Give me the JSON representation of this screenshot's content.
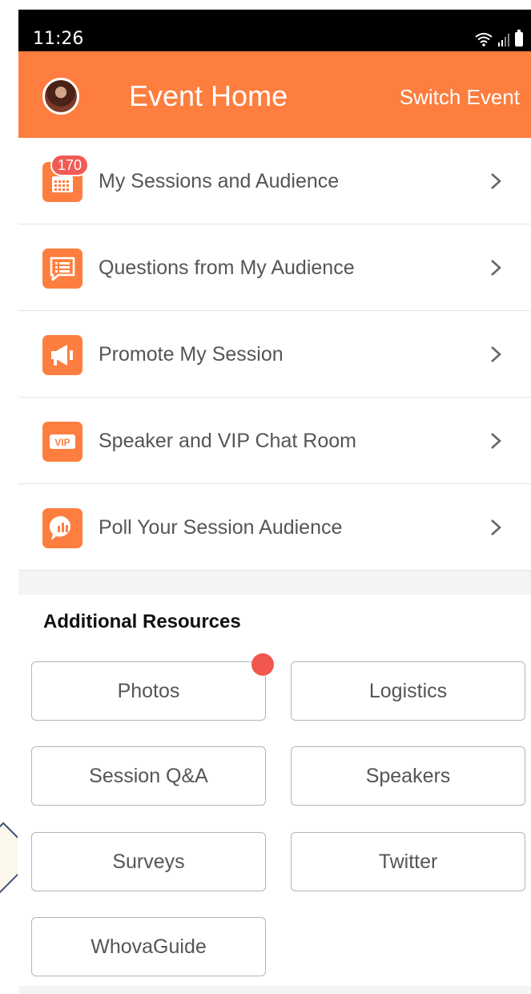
{
  "status_bar": {
    "time": "11:26"
  },
  "header": {
    "title": "Event Home",
    "switch_label": "Switch Event",
    "color": "#fd7e3f"
  },
  "menu": [
    {
      "label": "My Sessions and Audience",
      "icon": "calendar-icon",
      "badge": "170"
    },
    {
      "label": "Questions from My Audience",
      "icon": "question-list-icon"
    },
    {
      "label": "Promote My Session",
      "icon": "megaphone-icon"
    },
    {
      "label": "Speaker and VIP Chat Room",
      "icon": "vip-icon",
      "icon_text": "VIP"
    },
    {
      "label": "Poll Your Session Audience",
      "icon": "poll-icon"
    }
  ],
  "resources": {
    "title": "Additional Resources",
    "buttons": [
      "Photos",
      "Logistics",
      "Session Q&A",
      "Speakers",
      "Surveys",
      "Twitter",
      "WhovaGuide"
    ]
  }
}
